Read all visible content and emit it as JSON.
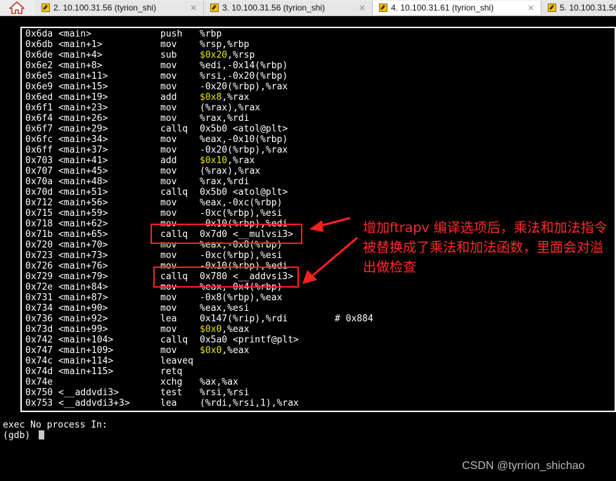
{
  "tabs": [
    {
      "label": "2. 10.100.31.56 (tyrion_shi)",
      "close": "×",
      "active": false
    },
    {
      "label": "3. 10.100.31.56 (tyrion_shi)",
      "close": "×",
      "active": false
    },
    {
      "label": "4. 10.100.31.61 (tyrion_shi)",
      "close": "×",
      "active": true
    },
    {
      "label": "5. 10.100.31.56 (",
      "close": "",
      "active": false
    }
  ],
  "home_icon": "home-icon",
  "asm": [
    {
      "addr": "0x6da <main>",
      "op": "push",
      "args": [
        {
          "t": "%rbp"
        }
      ]
    },
    {
      "addr": "0x6db <main+1>",
      "op": "mov",
      "args": [
        {
          "t": "%rsp,%rbp"
        }
      ]
    },
    {
      "addr": "0x6de <main+4>",
      "op": "sub",
      "args": [
        {
          "t": "$0x20",
          "imm": true
        },
        {
          "t": ",%rsp"
        }
      ]
    },
    {
      "addr": "0x6e2 <main+8>",
      "op": "mov",
      "args": [
        {
          "t": "%edi,-0x14(%rbp)"
        }
      ]
    },
    {
      "addr": "0x6e5 <main+11>",
      "op": "mov",
      "args": [
        {
          "t": "%rsi,-0x20(%rbp)"
        }
      ]
    },
    {
      "addr": "0x6e9 <main+15>",
      "op": "mov",
      "args": [
        {
          "t": "-0x20(%rbp),%rax"
        }
      ]
    },
    {
      "addr": "0x6ed <main+19>",
      "op": "add",
      "args": [
        {
          "t": "$0x8",
          "imm": true
        },
        {
          "t": ",%rax"
        }
      ]
    },
    {
      "addr": "0x6f1 <main+23>",
      "op": "mov",
      "args": [
        {
          "t": "(%rax),%rax"
        }
      ]
    },
    {
      "addr": "0x6f4 <main+26>",
      "op": "mov",
      "args": [
        {
          "t": "%rax,%rdi"
        }
      ]
    },
    {
      "addr": "0x6f7 <main+29>",
      "op": "callq",
      "args": [
        {
          "t": "0x5b0 <atol@plt>"
        }
      ]
    },
    {
      "addr": "0x6fc <main+34>",
      "op": "mov",
      "args": [
        {
          "t": "%eax,-0x10(%rbp)"
        }
      ]
    },
    {
      "addr": "0x6ff <main+37>",
      "op": "mov",
      "args": [
        {
          "t": "-0x20(%rbp),%rax"
        }
      ]
    },
    {
      "addr": "0x703 <main+41>",
      "op": "add",
      "args": [
        {
          "t": "$0x10",
          "imm": true
        },
        {
          "t": ",%rax"
        }
      ]
    },
    {
      "addr": "0x707 <main+45>",
      "op": "mov",
      "args": [
        {
          "t": "(%rax),%rax"
        }
      ]
    },
    {
      "addr": "0x70a <main+48>",
      "op": "mov",
      "args": [
        {
          "t": "%rax,%rdi"
        }
      ]
    },
    {
      "addr": "0x70d <main+51>",
      "op": "callq",
      "args": [
        {
          "t": "0x5b0 <atol@plt>"
        }
      ]
    },
    {
      "addr": "0x712 <main+56>",
      "op": "mov",
      "args": [
        {
          "t": "%eax,-0xc(%rbp)"
        }
      ]
    },
    {
      "addr": "0x715 <main+59>",
      "op": "mov",
      "args": [
        {
          "t": "-0xc(%rbp),%esi"
        }
      ]
    },
    {
      "addr": "0x718 <main+62>",
      "op": "mov",
      "args": [
        {
          "t": "-0x10(%rbp),%edi"
        }
      ]
    },
    {
      "addr": "0x71b <main+65>",
      "op": "callq",
      "args": [
        {
          "t": "0x7d0 <__mulvsi3>"
        }
      ]
    },
    {
      "addr": "0x720 <main+70>",
      "op": "mov",
      "args": [
        {
          "t": "%eax,-0x8(%rbp)"
        }
      ]
    },
    {
      "addr": "0x723 <main+73>",
      "op": "mov",
      "args": [
        {
          "t": "-0xc(%rbp),%esi"
        }
      ]
    },
    {
      "addr": "0x726 <main+76>",
      "op": "mov",
      "args": [
        {
          "t": "-0x10(%rbp),%edi"
        }
      ]
    },
    {
      "addr": "0x729 <main+79>",
      "op": "callq",
      "args": [
        {
          "t": "0x780 <__addvsi3>"
        }
      ]
    },
    {
      "addr": "0x72e <main+84>",
      "op": "mov",
      "args": [
        {
          "t": "%eax,-0x4(%rbp)"
        }
      ]
    },
    {
      "addr": "0x731 <main+87>",
      "op": "mov",
      "args": [
        {
          "t": "-0x8(%rbp),%eax"
        }
      ]
    },
    {
      "addr": "0x734 <main+90>",
      "op": "mov",
      "args": [
        {
          "t": "%eax,%esi"
        }
      ]
    },
    {
      "addr": "0x736 <main+92>",
      "op": "lea",
      "args": [
        {
          "t": "0x147(%rip),%rdi"
        }
      ],
      "comment": "# 0x884"
    },
    {
      "addr": "0x73d <main+99>",
      "op": "mov",
      "args": [
        {
          "t": "$0x0",
          "imm": true
        },
        {
          "t": ",%eax"
        }
      ]
    },
    {
      "addr": "0x742 <main+104>",
      "op": "callq",
      "args": [
        {
          "t": "0x5a0 <printf@plt>"
        }
      ]
    },
    {
      "addr": "0x747 <main+109>",
      "op": "mov",
      "args": [
        {
          "t": "$0x0",
          "imm": true
        },
        {
          "t": ",%eax"
        }
      ]
    },
    {
      "addr": "0x74c <main+114>",
      "op": "leaveq",
      "args": []
    },
    {
      "addr": "0x74d <main+115>",
      "op": "retq",
      "args": []
    },
    {
      "addr": "0x74e",
      "op": "xchg",
      "args": [
        {
          "t": "%ax,%ax"
        }
      ]
    },
    {
      "addr": "0x750 <__addvdi3>",
      "op": "test",
      "args": [
        {
          "t": "%rsi,%rsi"
        }
      ]
    },
    {
      "addr": "0x753 <__addvdi3+3>",
      "op": "lea",
      "args": [
        {
          "t": "(%rdi,%rsi,1),%rax"
        }
      ]
    }
  ],
  "annotation": "增加ftrapv 编译选项后，乘法和加法指令被替换成了乘法和加法函数，里面会对溢出做检查",
  "status_line": "exec No process In:",
  "prompt": "(gdb) ",
  "watermark": "CSDN @tyrrion_shichao",
  "colors": {
    "annotation": "#ff2a2a",
    "immediate": "#e8e800",
    "box": "#ff2020"
  }
}
